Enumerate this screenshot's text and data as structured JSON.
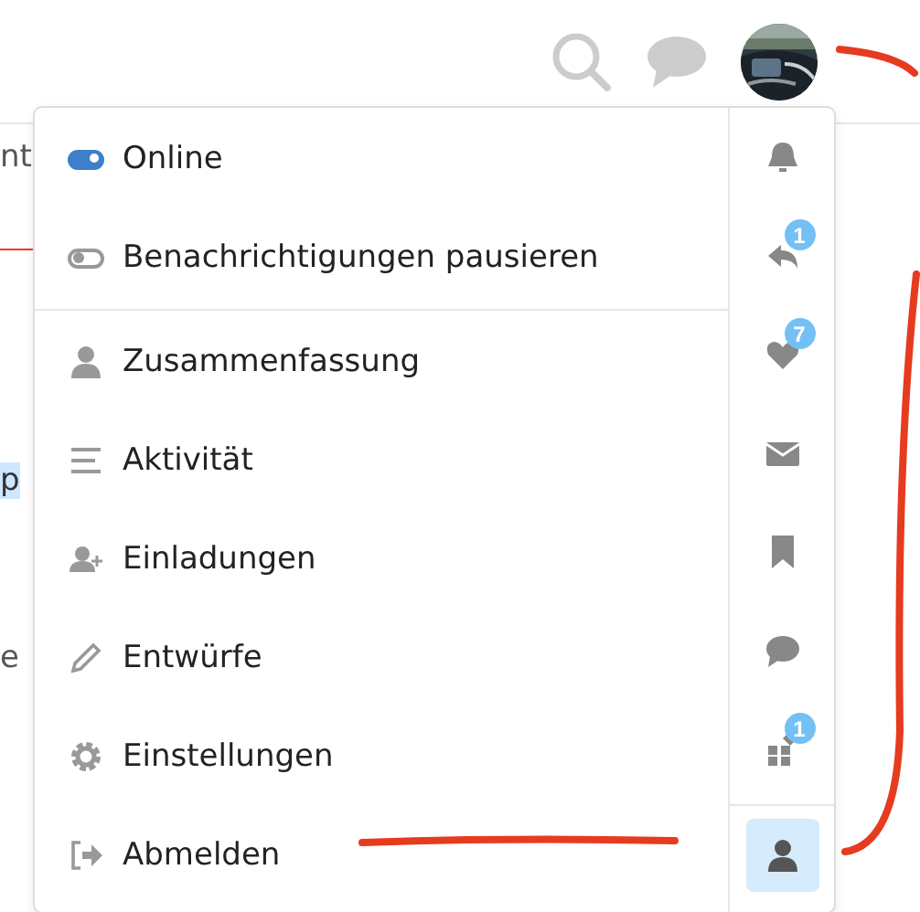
{
  "background": {
    "texts": [
      {
        "text": "nt",
        "highlighted": false
      },
      {
        "text": "p",
        "highlighted": true
      },
      {
        "text": "e",
        "highlighted": false
      }
    ]
  },
  "user_menu": {
    "status_items": [
      {
        "label": "Online",
        "on": true
      },
      {
        "label": "Benachrichtigungen pausieren",
        "on": false
      }
    ],
    "items": [
      {
        "label": "Zusammenfassung"
      },
      {
        "label": "Aktivität"
      },
      {
        "label": "Einladungen"
      },
      {
        "label": "Entwürfe"
      },
      {
        "label": "Einstellungen"
      },
      {
        "label": "Abmelden"
      }
    ],
    "tabs": [
      {
        "selected": false
      },
      {
        "badge": "1",
        "selected": false
      },
      {
        "badge": "7",
        "selected": false
      },
      {
        "selected": false
      },
      {
        "selected": false
      },
      {
        "selected": false
      },
      {
        "badge": "1",
        "selected": false
      },
      {
        "selected": true
      }
    ]
  }
}
